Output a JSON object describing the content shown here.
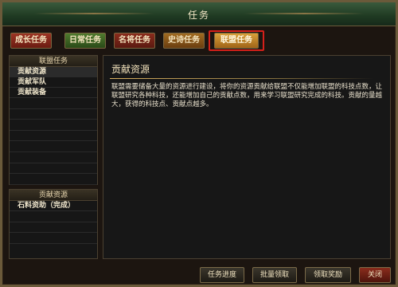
{
  "window": {
    "title": "任务"
  },
  "tabs": [
    {
      "label": "成长任务",
      "style": "red"
    },
    {
      "label": "日常任务",
      "style": "green"
    },
    {
      "label": "名将任务",
      "style": "dkred"
    },
    {
      "label": "史诗任务",
      "style": "brown"
    },
    {
      "label": "联盟任务",
      "style": "active"
    }
  ],
  "left_panel": {
    "header": "联盟任务",
    "items": [
      {
        "label": "贡献资源",
        "selected": true
      },
      {
        "label": "贡献军队",
        "selected": false
      },
      {
        "label": "贡献装备",
        "selected": false
      }
    ]
  },
  "sub_panel": {
    "header": "贡献资源",
    "items": [
      {
        "label": "石料资助（完成）"
      }
    ]
  },
  "main": {
    "section_title": "贡献资源",
    "description": "联盟需要储备大量的资源进行建设，将你的资源贡献给联盟不仅能增加联盟的科技点数，让联盟研究各种科技，还能增加自己的贡献点数，用来学习联盟研究完成的科技。贡献的量越大，获得的科技点、贡献点越多。"
  },
  "buttons": {
    "progress": "任务进度",
    "batch_claim": "批量领取",
    "claim_reward": "领取奖励",
    "close": "关闭"
  },
  "colors": {
    "highlight": "#d6201a",
    "title_bar": "#1f3a22"
  }
}
